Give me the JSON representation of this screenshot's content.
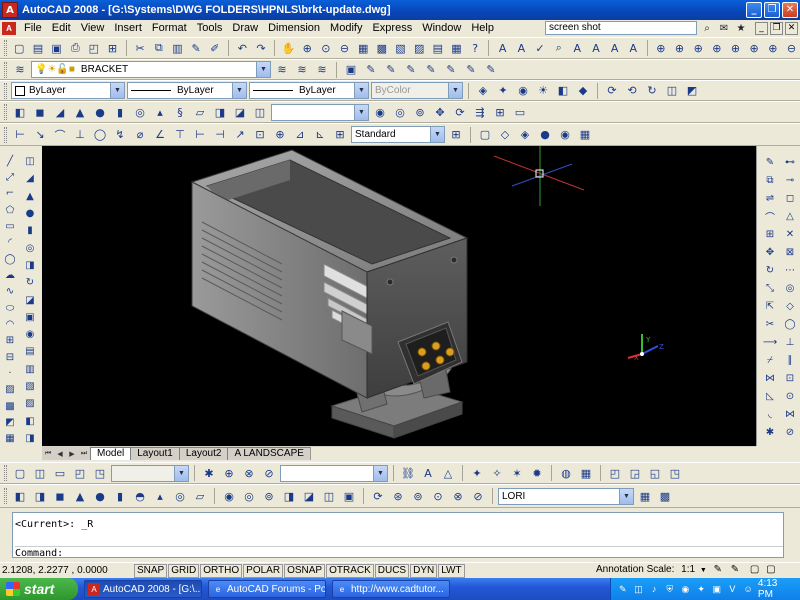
{
  "window": {
    "title": "AutoCAD 2008 - [G:\\Systems\\DWG FOLDERS\\HPNLS\\brkt-update.dwg]",
    "app_icon": "autocad-logo-icon",
    "controls": [
      "minimize-icon",
      "restore-icon",
      "close-icon"
    ]
  },
  "menu": {
    "items": [
      "File",
      "Edit",
      "View",
      "Insert",
      "Format",
      "Tools",
      "Draw",
      "Dimension",
      "Modify",
      "Express",
      "Window",
      "Help"
    ],
    "help_search_value": "screen shot"
  },
  "toolbars": {
    "layer_value": "BRACKET",
    "color_value": "ByLayer",
    "linetype_value": "ByLayer",
    "lineweight_value": "ByLayer",
    "plotstyle_value": "ByColor",
    "text_style_value": "Standard",
    "layer2_value": "LORI"
  },
  "layout_tabs": [
    "Model",
    "Layout1",
    "Layout2",
    "A LANDSCAPE"
  ],
  "active_tab": "Model",
  "command": {
    "history_line": "<Current>: _R",
    "prompt": "Command:"
  },
  "status": {
    "coordinates": "2.1208, 2.2277 , 0.0000",
    "toggles": [
      "SNAP",
      "GRID",
      "ORTHO",
      "POLAR",
      "OSNAP",
      "OTRACK",
      "DUCS",
      "DYN",
      "LWT"
    ],
    "annotation_scale_label": "Annotation Scale:",
    "annotation_scale_value": "1:1"
  },
  "ucs_labels": {
    "x": "X",
    "y": "Y",
    "z": "Z"
  },
  "taskbar": {
    "start_label": "start",
    "tasks": [
      "AutoCAD 2008 - [G:\\...",
      "AutoCAD Forums - Po...",
      "http://www.cadtutor..."
    ],
    "clock": "4:13 PM"
  },
  "colors": {
    "canvas_bg": "#000000",
    "titlebar": "#0846b8",
    "model_grey": "#8c8c8c",
    "connector_pins": "#d8a020"
  }
}
